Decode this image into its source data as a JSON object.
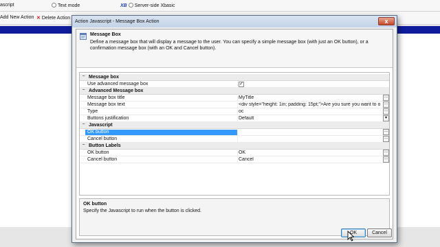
{
  "background": {
    "script_label": "ascript",
    "text_mode_label": "Text mode",
    "xbasic_icon": "XB",
    "server_side_label": "Server-side Xbasic",
    "add_action_label": "Add New Action",
    "delete_action_label": "Delete Action",
    "accent_color": "#0f1c9b"
  },
  "dialog": {
    "title": "Action Javascript - Message Box Action",
    "close_label": "x",
    "header": {
      "title": "Message Box",
      "description": "Define a message box that will display a message to the user. You can specify a simple message box (with just an OK button), or a confirmation message box (with an OK and Cancel button)."
    },
    "grid": {
      "sections": [
        {
          "label": "Message box"
        },
        {
          "label": "Advanced Message box"
        },
        {
          "label": "Javascript"
        },
        {
          "label": "Button Labels"
        }
      ],
      "rows": [
        {
          "name": "Use advanced message box",
          "value": ""
        },
        {
          "name": "Message box title",
          "value": "MyTitle"
        },
        {
          "name": "Message box text",
          "value": "<div style=\"height: 1in; padding: 15pt;\">Are you sure you want to open the"
        },
        {
          "name": "Type",
          "value": "oc"
        },
        {
          "name": "Buttons justification",
          "value": "Default"
        },
        {
          "name": "OK button",
          "value": ""
        },
        {
          "name": "Cancel button",
          "value": ""
        },
        {
          "name": "OK button",
          "value": "OK"
        },
        {
          "name": "Cancel button",
          "value": "Cancel"
        }
      ],
      "checked_mark": "✓",
      "expand_symbol": "−",
      "ellipsis": "...",
      "dropdown_arrow": "▾"
    },
    "help": {
      "title": "OK button",
      "text": "Specify the Javascript to run when the button is clicked."
    },
    "buttons": {
      "ok": "OK",
      "cancel": "Cancel"
    }
  }
}
